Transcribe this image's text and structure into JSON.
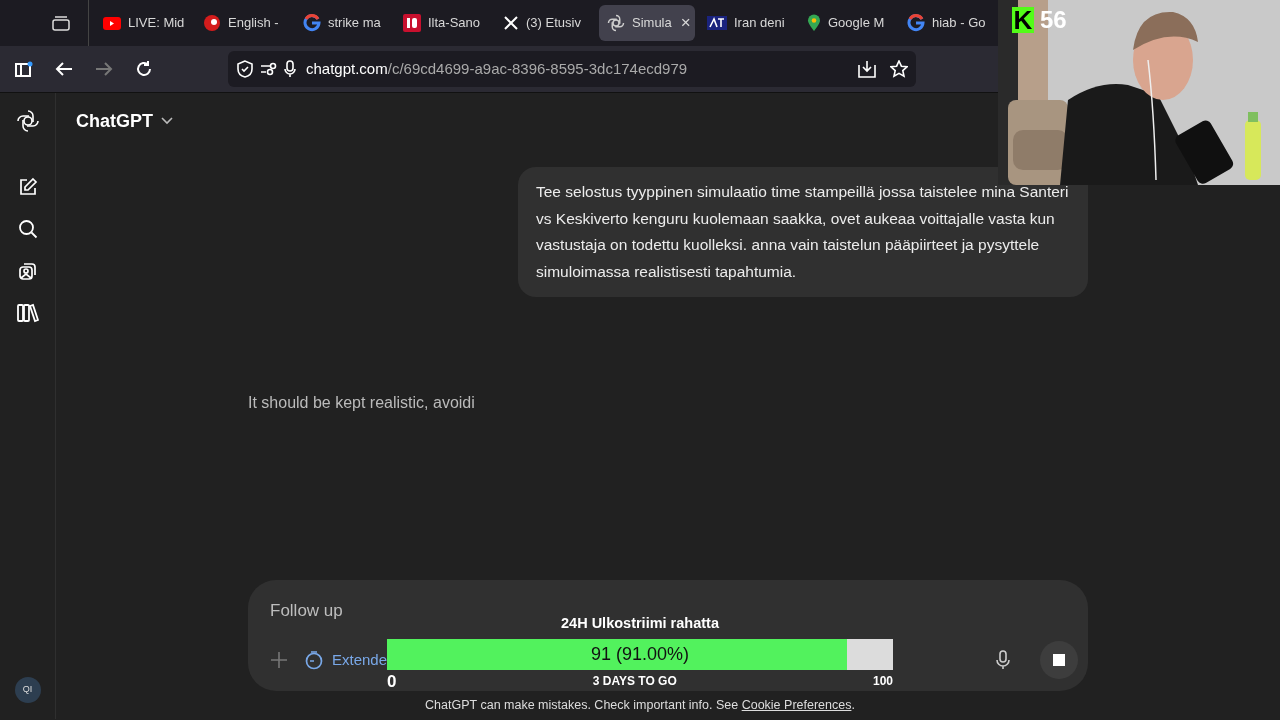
{
  "browser": {
    "tabs": [
      {
        "label": "LIVE: Mid",
        "kind": "youtube",
        "selected": false
      },
      {
        "label": "English -",
        "kind": "redcircle",
        "selected": false
      },
      {
        "label": "strike ma",
        "kind": "google",
        "selected": false
      },
      {
        "label": "Ilta-Sano",
        "kind": "is",
        "selected": false
      },
      {
        "label": "(3) Etusiv",
        "kind": "x",
        "selected": false
      },
      {
        "label": "Simula",
        "kind": "openai",
        "selected": true,
        "close": "×"
      },
      {
        "label": "Iran deni",
        "kind": "news",
        "selected": false
      },
      {
        "label": "Google M",
        "kind": "maps",
        "selected": false
      },
      {
        "label": "hiab - Go",
        "kind": "google",
        "selected": false
      }
    ],
    "address": {
      "host": "chatgpt.com",
      "path": "/c/69cd4699-a9ac-8396-8595-3dc174ecd979"
    }
  },
  "app": {
    "title": "ChatGPT",
    "avatar": "QI"
  },
  "messages": [
    {
      "kind": "user",
      "text": "Tee selostus tyyppinen simulaatio time stampeillä jossa taistelee mina Santeri vs Keskiverto kenguru kuolemaan saakka, ovet aukeaa voittajalle vasta kun vastustaja on todettu kuolleksi. anna vain taistelun pääpiirteet ja pysyttele simuloimassa realistisesti tapahtumia."
    },
    {
      "kind": "assistant",
      "text": "It should be kept realistic, avoidi"
    }
  ],
  "composer": {
    "placeholder": "Follow up",
    "mode": "Extende"
  },
  "footer": {
    "text": "ChatGPT can make mistakes. Check important info. See ",
    "link": "Cookie Preferences",
    "end": "."
  },
  "overlay": {
    "logo": "K",
    "viewers": "56",
    "goal": {
      "title": "24H Ulkostriimi rahatta",
      "level": 0.91,
      "reading": "91 (91.00%)",
      "min": "0",
      "subtitle": "3 DAYS TO GO",
      "max": "100"
    }
  }
}
